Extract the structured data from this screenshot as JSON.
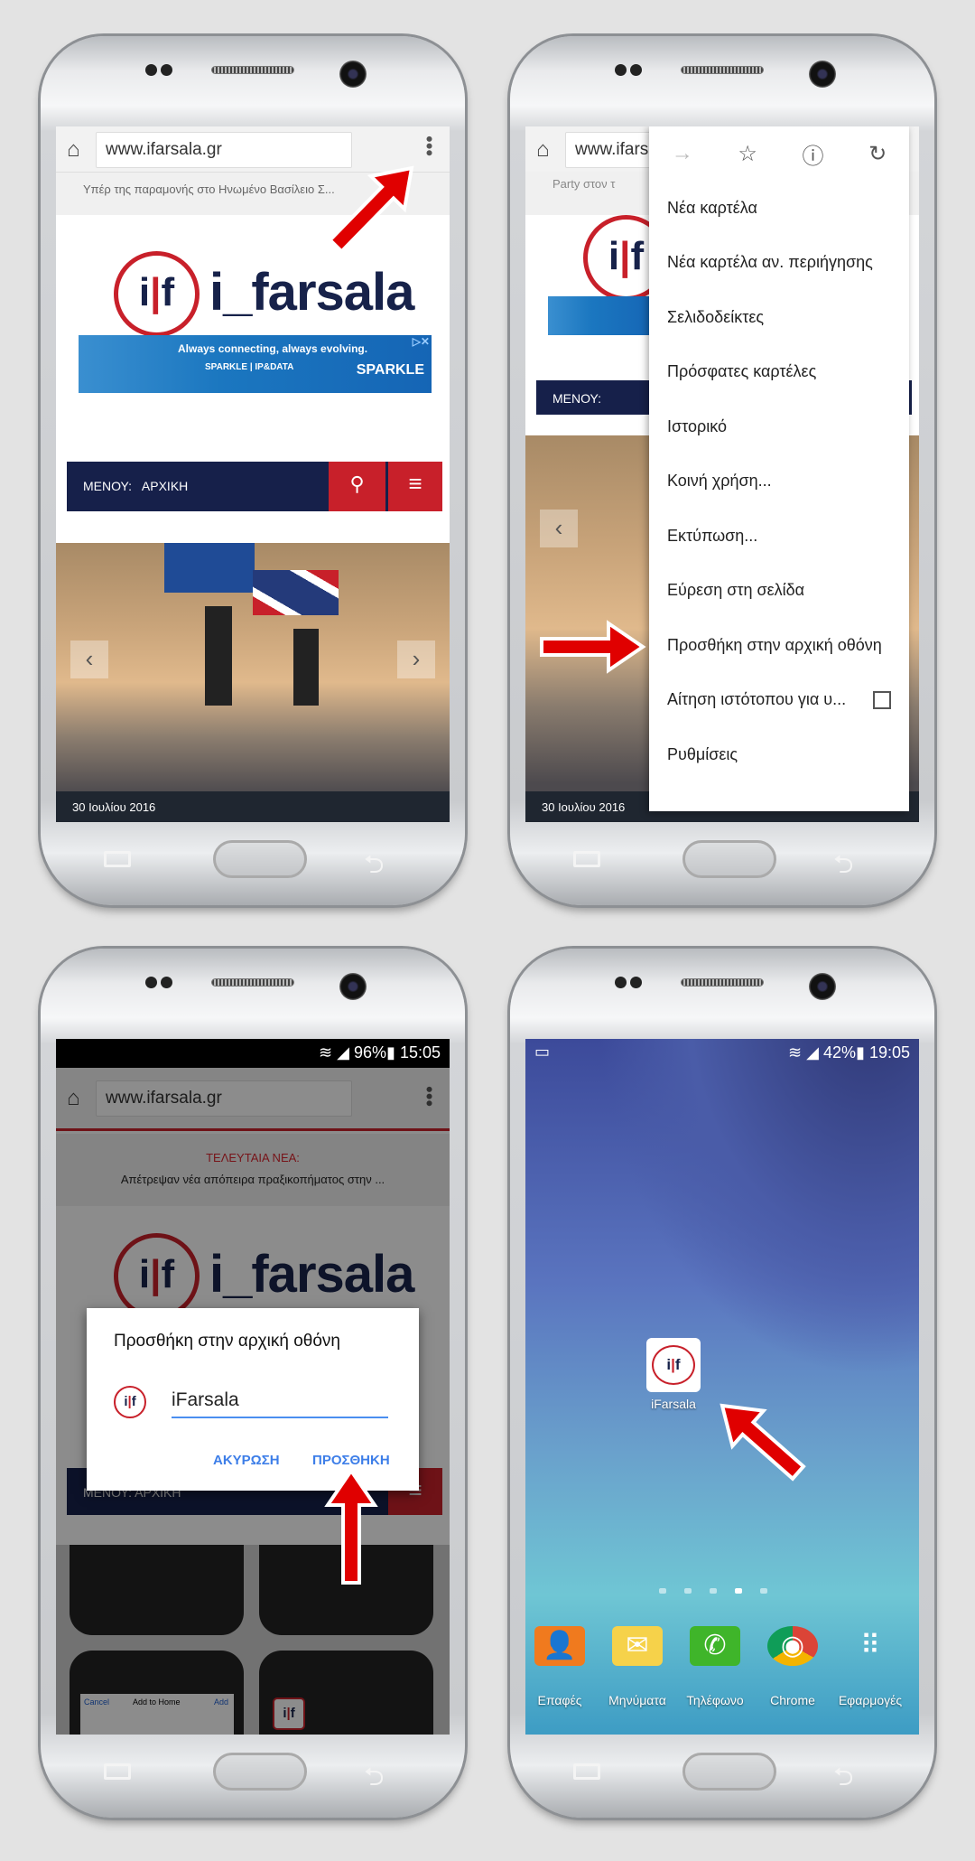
{
  "browser": {
    "url": "www.ifarsala.gr",
    "logo_text": "i_farsala",
    "logo_mark_left": "i",
    "logo_mark_right": "f"
  },
  "step1": {
    "headline": "Υπέρ της παραμονής στο Ηνωμένο Βασίλειο Σ...",
    "ad_text": "Always connecting, always evolving.",
    "ad_sub": "SPARKLE | IP&DATA",
    "ad_brand": "SPARKLE",
    "nav_label": "ΜΕΝΟΥ:",
    "nav_current": "ΑΡΧΙΚΗ",
    "hero_date": "30 Ιουλίου 2016"
  },
  "step2": {
    "headline": "Party στον τ",
    "menu_items": [
      {
        "label": "Νέα καρτέλα"
      },
      {
        "label": "Νέα καρτέλα αν. περιήγησης"
      },
      {
        "label": "Σελιδοδείκτες"
      },
      {
        "label": "Πρόσφατες καρτέλες"
      },
      {
        "label": "Ιστορικό"
      },
      {
        "label": "Κοινή χρήση..."
      },
      {
        "label": "Εκτύπωση..."
      },
      {
        "label": "Εύρεση στη σελίδα"
      },
      {
        "label": "Προσθήκη στην αρχική οθόνη"
      },
      {
        "label": "Αίτηση ιστότοπου για υ...",
        "checkbox": false
      },
      {
        "label": "Ρυθμίσεις"
      }
    ]
  },
  "step3": {
    "battery": "96%",
    "time": "15:05",
    "breaking_label": "ΤΕΛΕΥΤΑΙΑ ΝΕΑ:",
    "breaking_text": "Απέτρεψαν νέα απόπειρα πραξικοπήματος στην ...",
    "dialog_title": "Προσθήκη στην αρχική οθόνη",
    "dialog_value": "iFarsala",
    "cancel": "ΑΚΥΡΩΣΗ",
    "add": "ΠΡΟΣΘΗΚΗ",
    "thumb_add_home": "Add to Home",
    "thumb_cancel": "Cancel",
    "thumb_add": "Add"
  },
  "step4": {
    "battery": "42%",
    "time": "19:05",
    "shortcut_label": "iFarsala",
    "active_page": 4,
    "page_count": 5,
    "dock": [
      {
        "label": "Επαφές",
        "icon": "contacts-icon",
        "color": "#f07a1e"
      },
      {
        "label": "Μηνύματα",
        "icon": "messages-icon",
        "color": "#f6d24a"
      },
      {
        "label": "Τηλέφωνο",
        "icon": "phone-icon",
        "color": "#3fb52a"
      },
      {
        "label": "Chrome",
        "icon": "chrome-icon",
        "color": "#4285f4"
      },
      {
        "label": "Εφαρμογές",
        "icon": "apps-grid-icon",
        "color": "#ffffff"
      }
    ]
  },
  "colors": {
    "brand_red": "#c8202a",
    "brand_navy": "#17224a",
    "arrow_red": "#e00000",
    "dialog_blue": "#3d7ee8"
  }
}
